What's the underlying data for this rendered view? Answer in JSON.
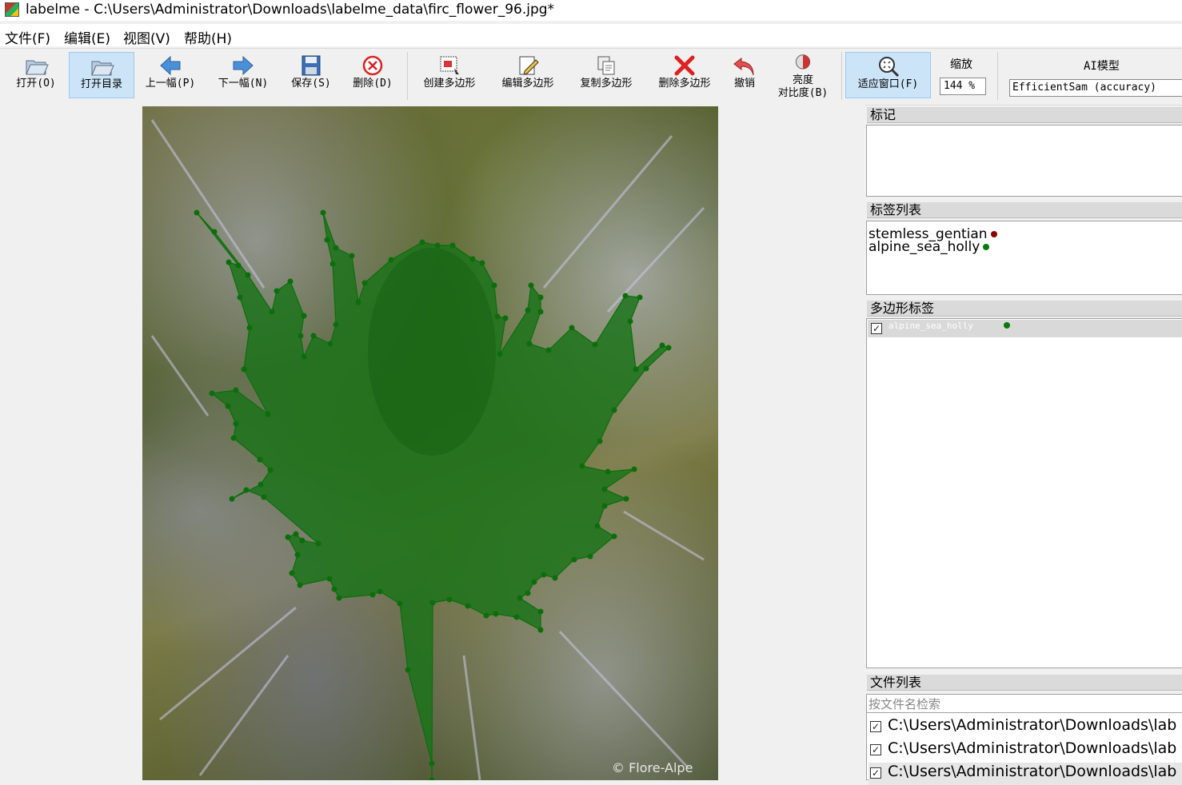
{
  "window": {
    "title": "labelme - C:\\Users\\Administrator\\Downloads\\labelme_data\\firc_flower_96.jpg*"
  },
  "menu": [
    "文件(F)",
    "编辑(E)",
    "视图(V)",
    "帮助(H)"
  ],
  "toolbar": {
    "open": "打开(O)",
    "open_dir": "打开目录",
    "prev": "上一幅(P)",
    "next": "下一幅(N)",
    "save": "保存(S)",
    "delete_file": "删除(D)",
    "create_polygon": "创建多边形",
    "edit_polygon": "编辑多边形",
    "copy_polygon": "复制多边形",
    "delete_polygon": "删除多边形",
    "undo": "撤销",
    "brightness_line1": "亮度",
    "brightness_line2": "对比度(B)",
    "fit_window": "适应窗口(F)",
    "zoom_label": "缩放",
    "zoom_value": "144 %",
    "ai_label": "AI模型",
    "ai_model": "EfficientSam (accuracy)"
  },
  "canvas": {
    "watermark": "© Flore-Alpe"
  },
  "panels": {
    "flags_title": "标记",
    "labels_title": "标签列表",
    "labels": [
      {
        "name": "stemless_gentian",
        "color": "#8b0000"
      },
      {
        "name": "alpine_sea_holly",
        "color": "#0a7a0a"
      }
    ],
    "polygons_title": "多边形标签",
    "polygons": [
      {
        "name": "alpine_sea_holly",
        "checked": true,
        "color": "#0a7a0a"
      }
    ],
    "files_title": "文件列表",
    "file_search_placeholder": "按文件名检索",
    "files": [
      "C:\\Users\\Administrator\\Downloads\\lab",
      "C:\\Users\\Administrator\\Downloads\\lab",
      "C:\\Users\\Administrator\\Downloads\\lab"
    ]
  },
  "colors": {
    "polygon_fill": "#1f7a1f",
    "vertex": "#0b6e0b",
    "accent": "#cce4f7"
  }
}
